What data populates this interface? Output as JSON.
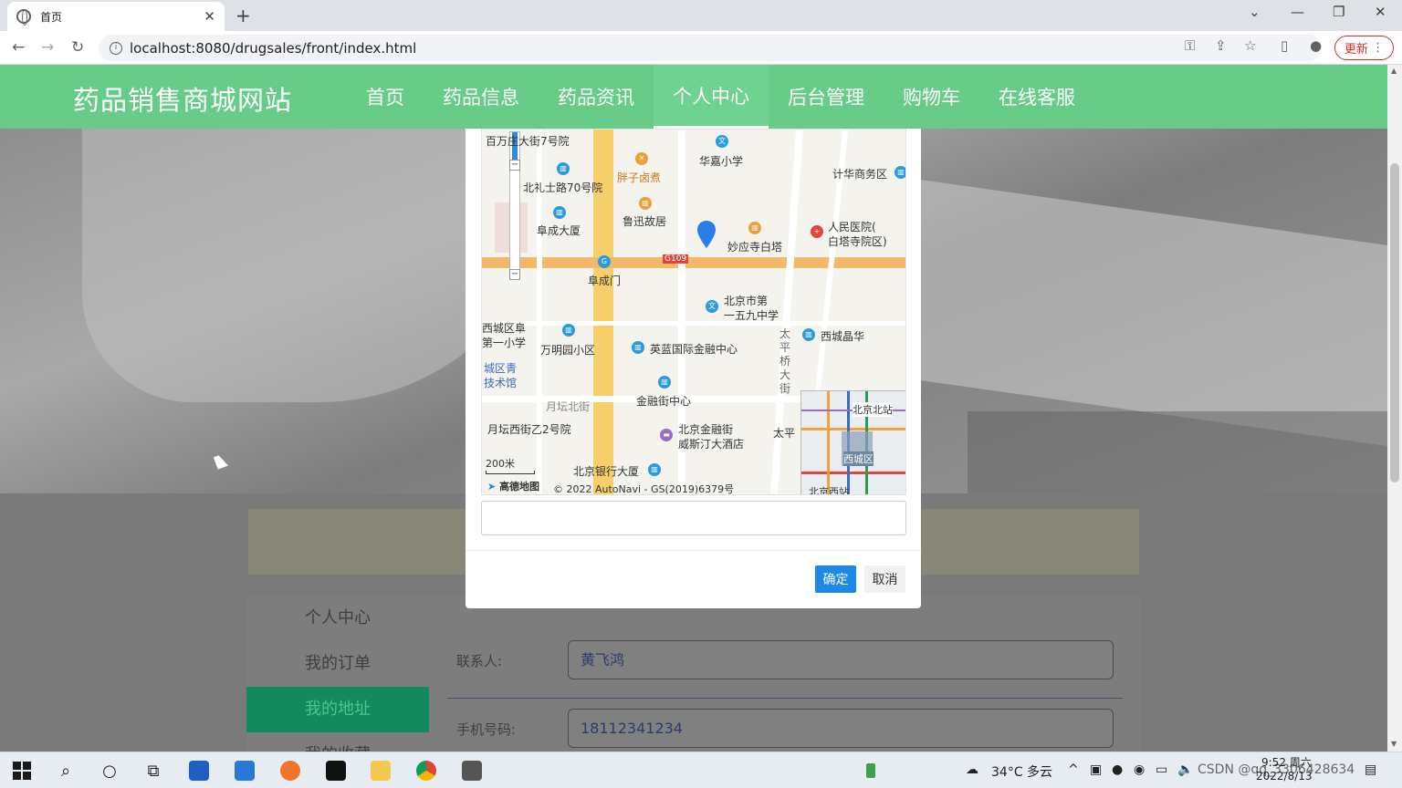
{
  "browser": {
    "tab_title": "首页",
    "url": "localhost:8080/drugsales/front/index.html",
    "update_label": "更新"
  },
  "site": {
    "logo": "药品销售商城网站",
    "menu": [
      {
        "label": "首页"
      },
      {
        "label": "药品信息"
      },
      {
        "label": "药品资讯"
      },
      {
        "label": "个人中心",
        "active": true
      },
      {
        "label": "后台管理"
      },
      {
        "label": "购物车"
      },
      {
        "label": "在线客服"
      }
    ]
  },
  "sidebar": {
    "items": [
      {
        "label": "个人中心"
      },
      {
        "label": "我的订单"
      },
      {
        "label": "我的地址",
        "active": true
      },
      {
        "label": "我的收藏"
      }
    ]
  },
  "form": {
    "contact_label": "联系人:",
    "contact_value": "黄飞鸿",
    "phone_label": "手机号码:",
    "phone_value": "18112341234"
  },
  "map": {
    "labels": {
      "l1": "百万庄大街7号院",
      "l2": "华嘉小学",
      "l3": "北礼士路70号院",
      "l4": "胖子卤煮",
      "l5": "计华商务区",
      "l6": "鲁迅故居",
      "l7": "阜成大厦",
      "l8": "妙应寺白塔",
      "l9": "人民医院(",
      "l10": "白塔寺院区)",
      "l11": "G109",
      "l12": "阜成门",
      "l13": "北京市第",
      "l14": "一五九中学",
      "l15": "西城区阜",
      "l16": "第一小学",
      "l17": "万明园小区",
      "l18": "英蓝国际金融中心",
      "l19": "西城晶华",
      "l20": "城区青",
      "l21": "技术馆",
      "l22": "金融街中心",
      "l23": "月坛北街",
      "l24": "月坛西街乙2号院",
      "l25": "北京金融街",
      "l26": "威斯汀大酒店",
      "l27": "太平",
      "l28": "北京银行大厦",
      "l29": "太平桥大街",
      "mm1": "北京北站",
      "mm2": "西城区",
      "mm3": "北京西站"
    },
    "scale": "200米",
    "logo": "高德地图",
    "copyright": "© 2022 AutoNavi - GS(2019)6379号"
  },
  "modal": {
    "address_value": "",
    "ok_label": "确定",
    "cancel_label": "取消"
  },
  "taskbar": {
    "weather": "34°C 多云",
    "time": "9:52 周六",
    "date": "2022/8/13",
    "tray_text": "CSDN @qq_3306428634"
  },
  "colors": {
    "header": "#66cc88",
    "primary_button": "#1e88e5",
    "sidebar_active": "#138a5e"
  }
}
